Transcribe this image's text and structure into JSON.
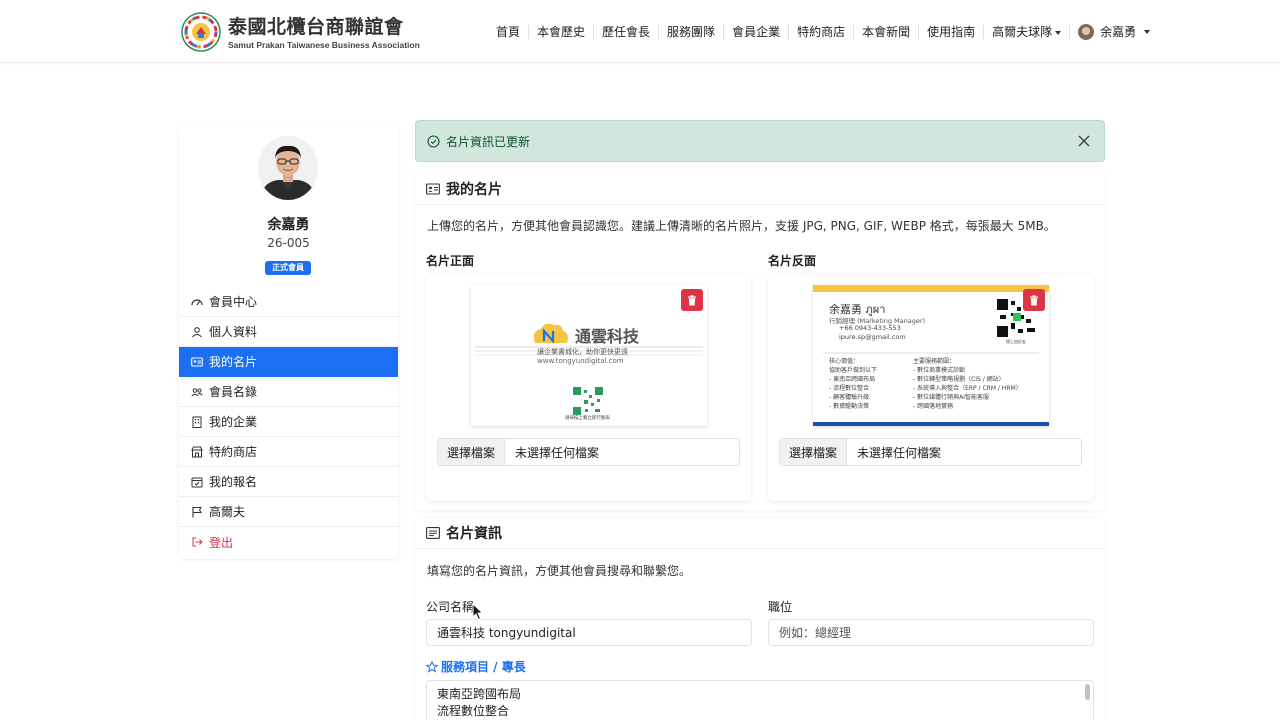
{
  "brand": {
    "title": "泰國北欖台商聯誼會",
    "subtitle": "Samut Prakan Taiwanese Business Association"
  },
  "nav": {
    "items": [
      "首頁",
      "本會歷史",
      "歷任會長",
      "服務團隊",
      "會員企業",
      "特約商店",
      "本會新聞",
      "使用指南"
    ],
    "golf": "高爾夫球隊",
    "user": "余嘉勇"
  },
  "profile": {
    "name": "余嘉勇",
    "member_id": "26-005",
    "badge": "正式會員"
  },
  "sidebar": {
    "items": [
      {
        "label": "會員中心",
        "icon": "dashboard-icon"
      },
      {
        "label": "個人資料",
        "icon": "user-icon"
      },
      {
        "label": "我的名片",
        "icon": "id-card-icon"
      },
      {
        "label": "會員名錄",
        "icon": "people-icon"
      },
      {
        "label": "我的企業",
        "icon": "building-icon"
      },
      {
        "label": "特約商店",
        "icon": "shop-icon"
      },
      {
        "label": "我的報名",
        "icon": "calendar-icon"
      },
      {
        "label": "高爾夫",
        "icon": "flag-icon"
      },
      {
        "label": "登出",
        "icon": "logout-icon"
      }
    ],
    "active_index": 2
  },
  "alert": {
    "text": "名片資訊已更新"
  },
  "my_card": {
    "title": "我的名片",
    "description": "上傳您的名片，方便其他會員認識您。建議上傳清晰的名片照片，支援 JPG, PNG, GIF, WEBP 格式，每張最大 5MB。",
    "front_label": "名片正面",
    "back_label": "名片反面",
    "file_button": "選擇檔案",
    "file_none": "未選擇任何檔案"
  },
  "front_card": {
    "company": "通雲科技",
    "slogan": "讓企業書城化，助你更快更遠",
    "url": "www.tongyundigital.com",
    "qr_caption": "請掃描上載立即行動表"
  },
  "back_card": {
    "name": "余嘉勇 ภูผา",
    "title": "行銷經理 (Marketing Manager)",
    "phone": "+66 0943-433-553",
    "email": "ipure.sp@gmail.com",
    "qr_caption": "掃上加好友",
    "left_heading": "核心價值：",
    "left_lines": [
      "協助客戶做到以下",
      "- 東南亞跨國布局",
      "- 流程數位整合",
      "- 顧客體驗升級",
      "- 數據驅動決策"
    ],
    "right_heading": "主要服務範圍：",
    "right_lines": [
      "- 數位商業模式診斷",
      "- 數位轉型策略規劃（CIS / 網站）",
      "- 系統導入與整合（ERP / CRM / HRM）",
      "- 數位媒體行銷與AI智能客服",
      "- 跨國落地實務"
    ]
  },
  "card_info": {
    "title": "名片資訊",
    "description": "填寫您的名片資訊，方便其他會員搜尋和聯繫您。",
    "company_label": "公司名稱",
    "company_value": "通雲科技 tongyundigital",
    "position_label": "職位",
    "position_placeholder": "例如：總經理",
    "services_label": "服務項目 / 專長",
    "services_lines": [
      "東南亞跨國布局",
      "流程數位整合"
    ]
  }
}
